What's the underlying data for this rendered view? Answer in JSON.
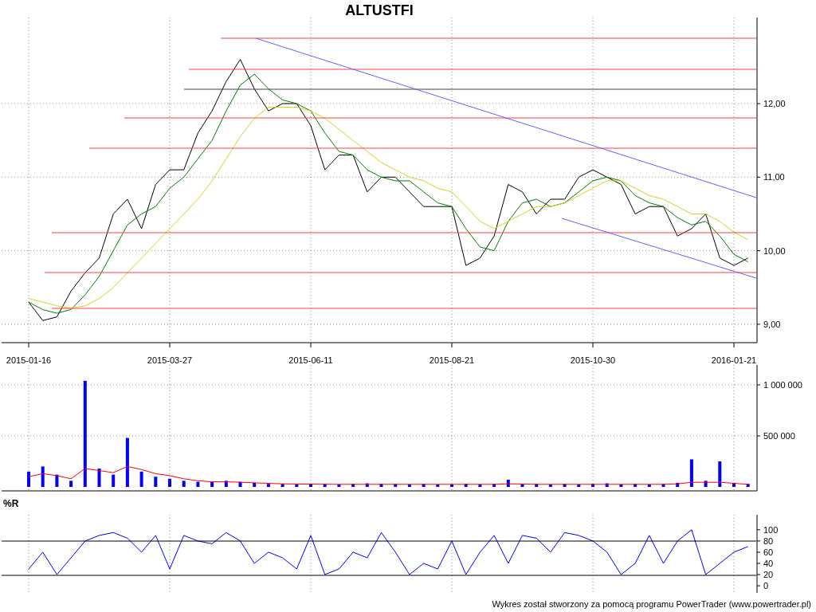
{
  "price_chart": {
    "chart_data": {
      "type": "line",
      "title": "ALTUSTFI",
      "categories": [
        "2015-01-16",
        null,
        null,
        null,
        null,
        null,
        null,
        null,
        null,
        null,
        "2015-03-27",
        null,
        null,
        null,
        null,
        null,
        null,
        null,
        null,
        null,
        "2015-06-11",
        null,
        null,
        null,
        null,
        null,
        null,
        null,
        null,
        null,
        "2015-08-21",
        null,
        null,
        null,
        null,
        null,
        null,
        null,
        null,
        null,
        "2015-10-30",
        null,
        null,
        null,
        null,
        null,
        null,
        null,
        null,
        null,
        "2016-01-21",
        null
      ],
      "ylim": [
        8.75,
        13.17
      ],
      "yticks": [
        {
          "value": 9,
          "label": "9,00"
        },
        {
          "value": 10,
          "label": "10,00"
        },
        {
          "value": 11,
          "label": "11,00"
        },
        {
          "value": 12,
          "label": "12,00"
        }
      ],
      "grid": true,
      "series": [
        {
          "color": "#000000",
          "values": [
            9.3,
            9.05,
            9.1,
            9.45,
            9.7,
            9.9,
            10.5,
            10.7,
            10.3,
            10.9,
            11.1,
            11.1,
            11.6,
            11.9,
            12.3,
            12.6,
            12.2,
            11.9,
            12.0,
            12.0,
            11.7,
            11.1,
            11.3,
            11.3,
            10.8,
            11.0,
            11.0,
            10.8,
            10.6,
            10.6,
            10.6,
            9.8,
            9.9,
            10.2,
            10.9,
            10.8,
            10.5,
            10.7,
            10.7,
            11.0,
            11.1,
            11.0,
            10.9,
            10.5,
            10.6,
            10.6,
            10.2,
            10.3,
            10.5,
            9.9,
            9.8,
            9.9
          ]
        },
        {
          "color": "#008000",
          "values": [
            9.3,
            9.2,
            9.15,
            9.2,
            9.4,
            9.65,
            10.0,
            10.35,
            10.5,
            10.6,
            10.85,
            11.0,
            11.25,
            11.5,
            11.9,
            12.25,
            12.4,
            12.2,
            12.05,
            12.0,
            11.9,
            11.6,
            11.35,
            11.3,
            11.1,
            11.0,
            10.95,
            10.95,
            10.8,
            10.65,
            10.6,
            10.3,
            10.05,
            10.0,
            10.4,
            10.65,
            10.7,
            10.6,
            10.65,
            10.8,
            10.95,
            11.0,
            10.95,
            10.75,
            10.65,
            10.6,
            10.45,
            10.35,
            10.4,
            10.2,
            9.95,
            9.85
          ]
        },
        {
          "color": "#d8d020",
          "values": [
            9.35,
            9.3,
            9.25,
            9.22,
            9.25,
            9.35,
            9.5,
            9.7,
            9.9,
            10.1,
            10.3,
            10.5,
            10.7,
            10.95,
            11.25,
            11.55,
            11.8,
            11.95,
            11.95,
            11.95,
            11.9,
            11.8,
            11.65,
            11.5,
            11.35,
            11.2,
            11.1,
            11.0,
            10.95,
            10.85,
            10.8,
            10.6,
            10.4,
            10.3,
            10.4,
            10.5,
            10.6,
            10.6,
            10.65,
            10.75,
            10.85,
            10.95,
            10.95,
            10.85,
            10.75,
            10.7,
            10.6,
            10.5,
            10.5,
            10.4,
            10.25,
            10.15
          ]
        }
      ]
    }
  },
  "volume_chart": {
    "chart_data": {
      "type": "bar",
      "categories": [
        null,
        null,
        null,
        null,
        null,
        null,
        null,
        null,
        null,
        null,
        null,
        null,
        null,
        null,
        null,
        null,
        null,
        null,
        null,
        null,
        null,
        null,
        null,
        null,
        null,
        null,
        null,
        null,
        null,
        null,
        null,
        null,
        null,
        null,
        null,
        null,
        null,
        null,
        null,
        null,
        null,
        null,
        null,
        null,
        null,
        null,
        null,
        null,
        null,
        null,
        null,
        null
      ],
      "ylim": [
        -39000,
        1195000
      ],
      "yticks": [
        {
          "value": 500000,
          "label": "500 000"
        },
        {
          "value": 1000000,
          "label": "1 000 000"
        }
      ],
      "grid": true,
      "series": [
        {
          "color": "#0000ff",
          "values": [
            150000,
            200000,
            120000,
            60000,
            1040000,
            180000,
            120000,
            480000,
            150000,
            100000,
            80000,
            60000,
            50000,
            50000,
            60000,
            50000,
            40000,
            30000,
            30000,
            25000,
            30000,
            30000,
            25000,
            30000,
            35000,
            30000,
            30000,
            25000,
            30000,
            25000,
            25000,
            30000,
            25000,
            30000,
            70000,
            30000,
            30000,
            25000,
            30000,
            25000,
            30000,
            35000,
            25000,
            30000,
            25000,
            30000,
            40000,
            270000,
            60000,
            250000,
            40000,
            30000
          ]
        },
        {
          "type": "line",
          "color": "#ff0000",
          "values": [
            100000,
            130000,
            110000,
            80000,
            180000,
            160000,
            140000,
            200000,
            170000,
            130000,
            110000,
            80000,
            60000,
            50000,
            50000,
            45000,
            40000,
            35000,
            30000,
            28000,
            27000,
            26000,
            25000,
            25000,
            25000,
            25000,
            25000,
            25000,
            25000,
            25000,
            25000,
            25000,
            25000,
            25000,
            30000,
            28000,
            25000,
            25000,
            25000,
            25000,
            25000,
            25000,
            25000,
            25000,
            25000,
            25000,
            30000,
            45000,
            45000,
            45000,
            35000,
            25000
          ]
        }
      ]
    }
  },
  "williams_r_chart": {
    "chart_data": {
      "type": "line",
      "title": "%R",
      "categories": [
        null,
        null,
        null,
        null,
        null,
        null,
        null,
        null,
        null,
        null,
        null,
        null,
        null,
        null,
        null,
        null,
        null,
        null,
        null,
        null,
        null,
        null,
        null,
        null,
        null,
        null,
        null,
        null,
        null,
        null,
        null,
        null,
        null,
        null,
        null,
        null,
        null,
        null,
        null,
        null,
        null,
        null,
        null,
        null,
        null,
        null,
        null,
        null,
        null,
        null,
        null,
        null
      ],
      "ylim": [
        -12.7,
        126.8
      ],
      "yticks": [
        {
          "value": 0,
          "label": "0"
        },
        {
          "value": 20,
          "label": "20"
        },
        {
          "value": 40,
          "label": "40"
        },
        {
          "value": 60,
          "label": "60"
        },
        {
          "value": 80,
          "label": "80"
        },
        {
          "value": 100,
          "label": "100"
        }
      ],
      "grid": true,
      "series": [
        {
          "color": "#0000ff",
          "values": [
            30,
            60,
            20,
            50,
            80,
            90,
            95,
            85,
            60,
            90,
            30,
            90,
            80,
            75,
            95,
            80,
            40,
            60,
            50,
            30,
            90,
            20,
            30,
            60,
            50,
            95,
            60,
            20,
            40,
            30,
            80,
            20,
            60,
            90,
            40,
            90,
            85,
            60,
            95,
            90,
            80,
            60,
            20,
            40,
            90,
            40,
            80,
            100,
            20,
            40,
            60,
            70
          ]
        }
      ]
    }
  },
  "footer": "Wykres został stworzony za pomocą programu PowerTrader (www.powertrader.pl)"
}
